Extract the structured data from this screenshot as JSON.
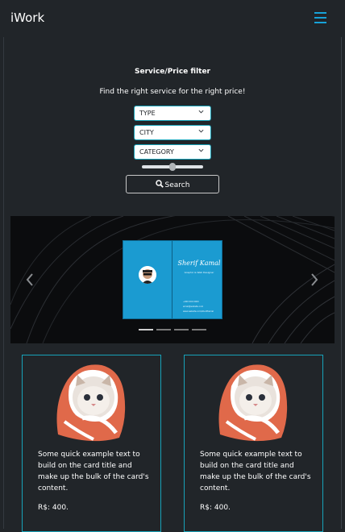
{
  "navbar": {
    "brand": "iWork"
  },
  "filter": {
    "title": "Service/Price filter",
    "subtitle": "Find the right service for the right price!",
    "selects": [
      {
        "value": "TYPE"
      },
      {
        "value": "CITY"
      },
      {
        "value": "CATEGORY"
      }
    ],
    "price_slider_level": 0.5,
    "search_label": "Search"
  },
  "carousel": {
    "slide": {
      "name": "Sherif Kamal",
      "role": "Graphic & Web Designer",
      "contacts": [
        "+000 000 0000",
        "email@website.com",
        "www.website.com/sherifkamal"
      ]
    },
    "indicator_count": 4,
    "active_indicator": 1
  },
  "cards": [
    {
      "text": "Some quick example text to build on the card title and make up the bulk of the card's content.",
      "price": "R$: 400."
    },
    {
      "text": "Some quick example text to build on the card title and make up the bulk of the card's content.",
      "price": "R$: 400."
    }
  ],
  "colors": {
    "accent": "#17a2b8",
    "background": "#212529",
    "card_blue": "#1b9bd1"
  }
}
